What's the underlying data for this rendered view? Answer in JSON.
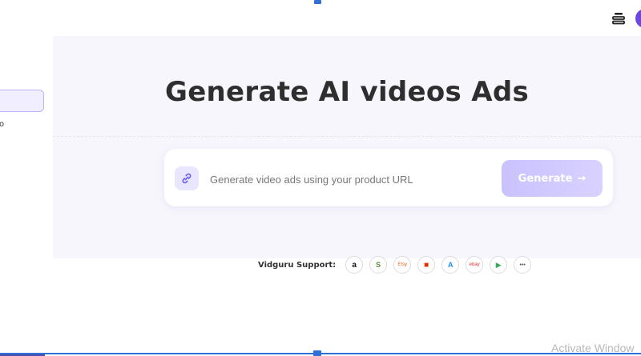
{
  "hero": {
    "title": "Generate AI videos Ads",
    "input_placeholder": "Generate video ads using your product URL",
    "generate_label": "Generate",
    "generate_arrow": "→"
  },
  "sidebar": {
    "fragment_text": "o"
  },
  "support": {
    "label": "Vidguru Support:",
    "platforms": [
      {
        "name": "amazon",
        "glyph": "a",
        "color": "#111111"
      },
      {
        "name": "shopify",
        "glyph": "S",
        "color": "#5e8e3e"
      },
      {
        "name": "etsy",
        "glyph": "Etsy",
        "color": "#f1641e"
      },
      {
        "name": "aliexpress",
        "glyph": "■",
        "color": "#e62e04"
      },
      {
        "name": "app-store",
        "glyph": "A",
        "color": "#1b8cf3"
      },
      {
        "name": "ebay",
        "glyph": "ebay",
        "color": "#e53238"
      },
      {
        "name": "google-play",
        "glyph": "▶",
        "color": "#34a853"
      },
      {
        "name": "more",
        "glyph": "•••",
        "color": "#555555"
      }
    ]
  },
  "watermark": "Activate Window",
  "colors": {
    "accent": "#6b47e6",
    "hero_bg": "#f7f6fd",
    "button_gradient_start": "#c9c2ff",
    "button_gradient_end": "#d9d2ff",
    "selection_blue": "#2f6fd6"
  },
  "icons": {
    "header_stack": "stack-icon",
    "link": "link-icon"
  }
}
